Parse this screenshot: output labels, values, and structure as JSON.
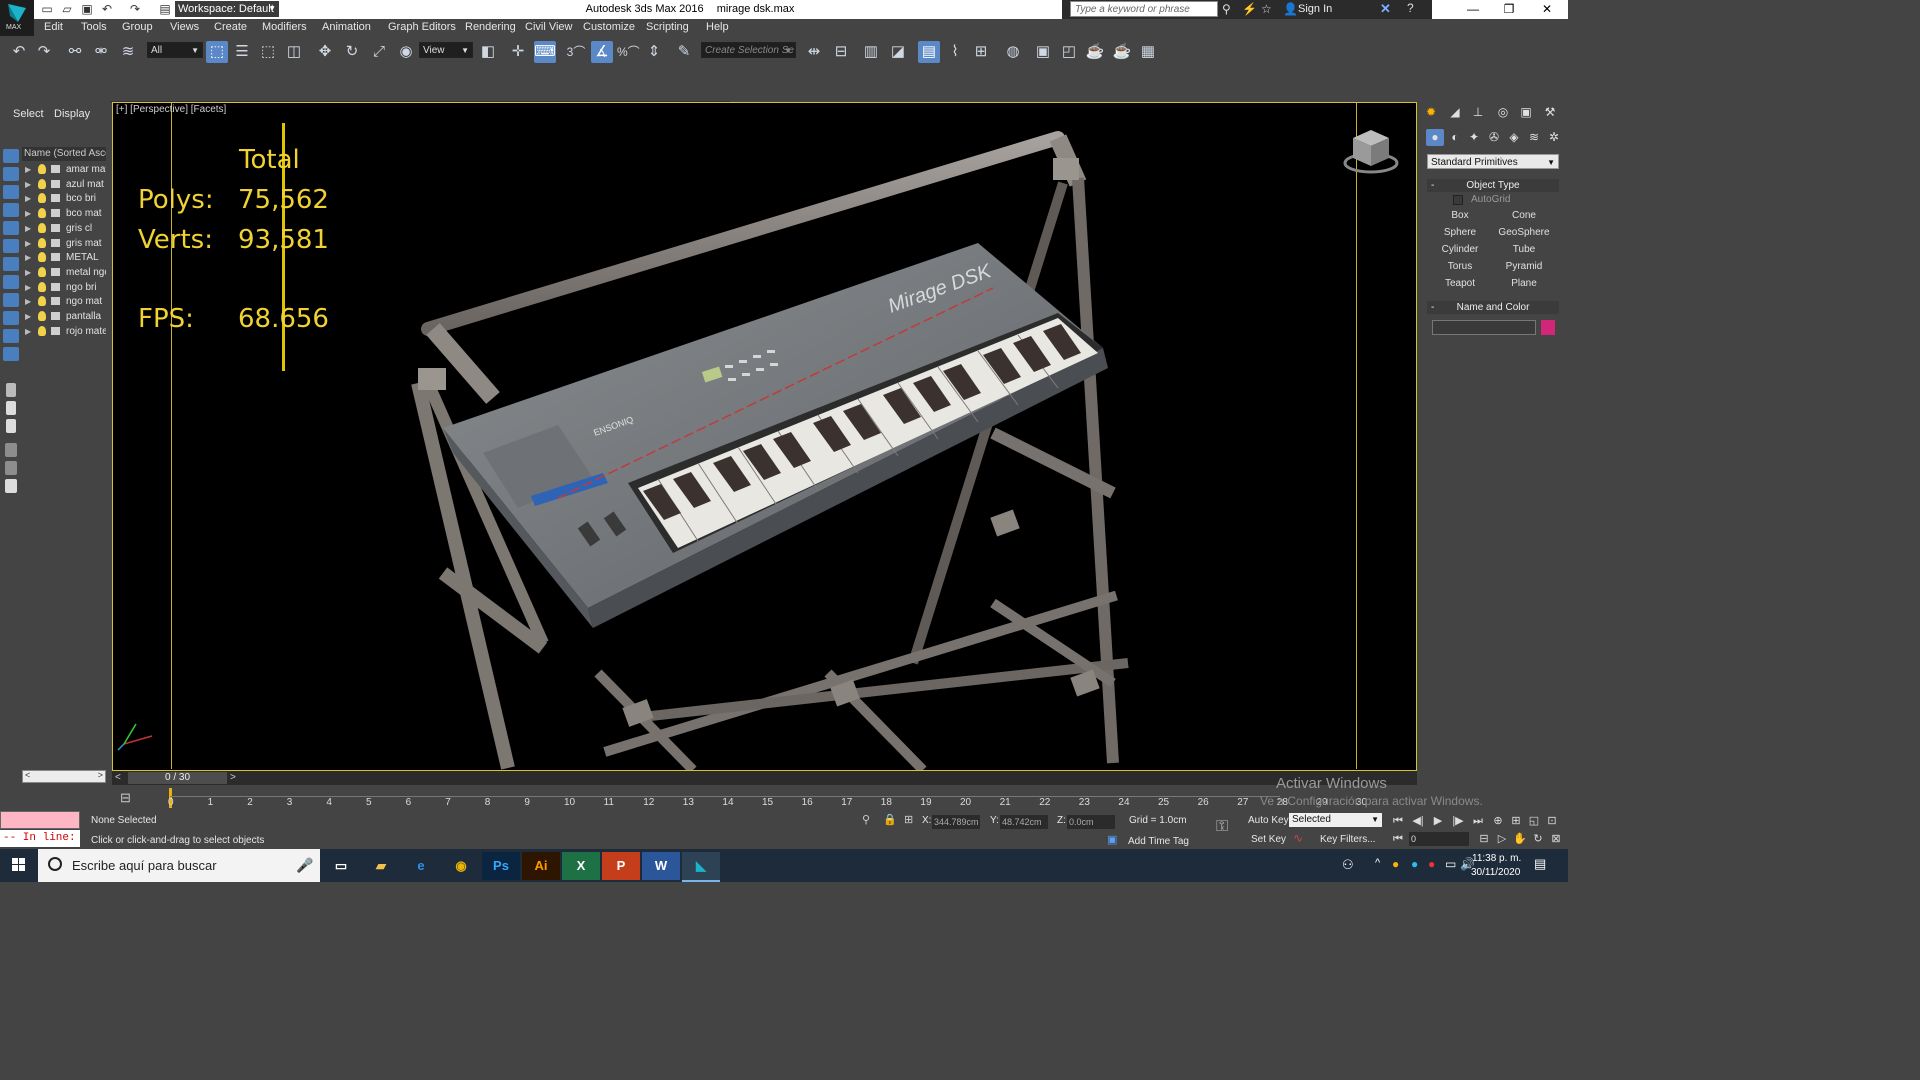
{
  "app": {
    "title": "Autodesk 3ds Max 2016",
    "file": "mirage dsk.max",
    "workspace": "Workspace: Default",
    "search_placeholder": "Type a keyword or phrase",
    "sign_in": "Sign In",
    "logo_text": "MAX"
  },
  "menu": [
    "Edit",
    "Tools",
    "Group",
    "Views",
    "Create",
    "Modifiers",
    "Animation",
    "Graph Editors",
    "Rendering",
    "Civil View",
    "Customize",
    "Scripting",
    "Help"
  ],
  "toolbar": {
    "filter_select": "All",
    "view_select": "View",
    "snap_label": "3",
    "percent_label": "%",
    "selection_set_placeholder": "Create Selection Se"
  },
  "explorer": {
    "tabs": [
      "Select",
      "Display"
    ],
    "header": "Name (Sorted Ascen",
    "items": [
      "amar mat",
      "azul mat",
      "bco bri",
      "bco mat",
      "gris cl",
      "gris mat",
      "METAL",
      "metal ngo",
      "ngo bri",
      "ngo mat",
      "pantalla",
      "rojo mate"
    ]
  },
  "viewport": {
    "label": "[+] [Perspective] [Facets]",
    "stats": {
      "total_label": "Total",
      "polys_label": "Polys:",
      "polys_value": "75,562",
      "verts_label": "Verts:",
      "verts_value": "93,581",
      "fps_label": "FPS:",
      "fps_value": "68.656"
    },
    "model_brand": "Mirage DSK",
    "model_maker": "ENSONIQ"
  },
  "command_panel": {
    "category": "Standard Primitives",
    "object_type_title": "Object Type",
    "autogrid": "AutoGrid",
    "buttons": [
      "Box",
      "Cone",
      "Sphere",
      "GeoSphere",
      "Cylinder",
      "Tube",
      "Torus",
      "Pyramid",
      "Teapot",
      "Plane"
    ],
    "name_color_title": "Name and Color",
    "swatch_color": "#d22679"
  },
  "timeline": {
    "frame_indicator": "0 / 30",
    "ticks": [
      "0",
      "1",
      "2",
      "3",
      "4",
      "5",
      "6",
      "7",
      "8",
      "9",
      "10",
      "11",
      "12",
      "13",
      "14",
      "15",
      "16",
      "17",
      "18",
      "19",
      "20",
      "21",
      "22",
      "23",
      "24",
      "25",
      "26",
      "27",
      "28",
      "29",
      "30"
    ]
  },
  "status": {
    "maxscript_prompt": "-- In line:",
    "selection": "None Selected",
    "hint": "Click or click-and-drag to select objects",
    "x_label": "X:",
    "x_value": "344.789cm",
    "y_label": "Y:",
    "y_value": "48.742cm",
    "z_label": "Z:",
    "z_value": "0.0cm",
    "grid": "Grid = 1.0cm",
    "add_time_tag": "Add Time Tag",
    "auto_key": "Auto Key",
    "set_key": "Set Key",
    "key_mode": "Selected",
    "key_filters": "Key Filters...",
    "frame": "0"
  },
  "windows": {
    "activate_title": "Activar Windows",
    "activate_sub": "Ve a Configuración para activar Windows.",
    "search": "Escribe aquí para buscar",
    "time": "11:38 p. m.",
    "date": "30/11/2020",
    "apps": {
      "ps": "Ps",
      "ai": "Ai",
      "excel": "X",
      "ppt": "P",
      "word": "W"
    }
  }
}
